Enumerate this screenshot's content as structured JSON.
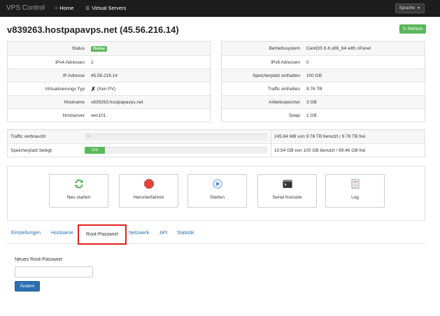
{
  "nav": {
    "brand": "VPS Control",
    "home": "Home",
    "servers": "Virtual Servers",
    "language": "Sprache"
  },
  "page": {
    "title": "v839263.hostpapavps.net (45.56.216.14)",
    "refresh_label": "Refresh"
  },
  "info_left": [
    {
      "label": "Status",
      "value": "Online"
    },
    {
      "label": "IPv4 Adressen",
      "value": "2"
    },
    {
      "label": "IP Adresse",
      "value": "45.56.216.14"
    },
    {
      "label": "Virtualisierungs Typ",
      "value": "(Xen PV)"
    },
    {
      "label": "Hostname",
      "value": "v839263.hostpapavps.net"
    },
    {
      "label": "Hostserver",
      "value": "xen101"
    }
  ],
  "info_right": [
    {
      "label": "Betriebssystem",
      "value": "CentOS 6.6 x86_64 with cPanel"
    },
    {
      "label": "IPv6 Adressen",
      "value": "0"
    },
    {
      "label": "Speicherplatz enthalten",
      "value": "100 GB"
    },
    {
      "label": "Traffic enthalten",
      "value": "9.76 TB"
    },
    {
      "label": "Arbeitsspeicher",
      "value": "3 GB"
    },
    {
      "label": "Swap",
      "value": "1 GB"
    }
  ],
  "usage": [
    {
      "label": "Traffic verbraucht",
      "percent_text": "0%",
      "percent": 0,
      "detail": "245.84 MB von 9.76 TB benutzt / 9.76 TB frei"
    },
    {
      "label": "Speicherplatz belegt",
      "percent_text": "11%",
      "percent": 11,
      "detail": "10.54 GB von 100 GB benutzt / 89.46 GB frei"
    }
  ],
  "actions": [
    {
      "label": "Neu starten",
      "icon": "refresh-icon"
    },
    {
      "label": "Herunterfahren",
      "icon": "stop-icon"
    },
    {
      "label": "Starten",
      "icon": "play-icon"
    },
    {
      "label": "Serial Konsole",
      "icon": "console-icon"
    },
    {
      "label": "Log",
      "icon": "log-icon"
    }
  ],
  "tabs": [
    {
      "label": "Einstellungen"
    },
    {
      "label": "Hostname"
    },
    {
      "label": "Root-Passwort",
      "active": true
    },
    {
      "label": "Netzwerk"
    },
    {
      "label": "API"
    },
    {
      "label": "Statistik"
    }
  ],
  "form": {
    "label": "Neues Root-Passwort",
    "value": "",
    "submit_label": "Ändern"
  },
  "colors": {
    "navbar": "#1d1d1d",
    "success": "#5cb85c",
    "primary": "#2a6fb0",
    "highlight": "#e02020"
  }
}
